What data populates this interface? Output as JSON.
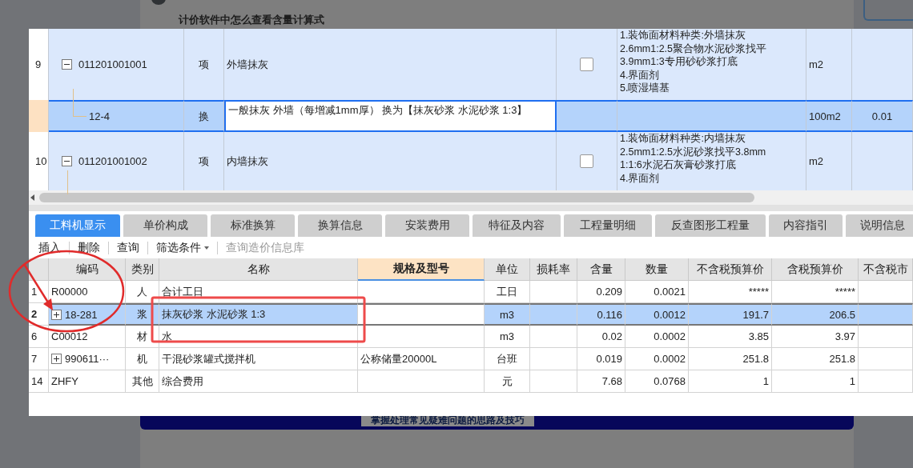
{
  "background_page": {
    "article_title": "计价软件中怎么查看含量计算式",
    "banner_text": "掌握处理常见疑难问题的思路及技巧"
  },
  "top_grid": {
    "rows": [
      {
        "number": "9",
        "code": "011201001001",
        "type": "项",
        "name": "外墙抹灰",
        "checked": false,
        "features": "1.装饰面材料种类:外墙抹灰\n2.6mm1:2.5聚合物水泥砂浆找平\n3.9mm1:3专用砂砂浆打底\n4.界面剂\n5.喷湿墙基",
        "unit": "m2",
        "expanded": true,
        "selected": false,
        "children": [
          {
            "code": "12-4",
            "type": "换",
            "name": "一般抹灰 外墙（每增减1mm厚） 换为【抹灰砂浆 水泥砂浆 1:3】",
            "unit": "100m2",
            "column_8": "0.01",
            "selected": true
          }
        ]
      },
      {
        "number": "10",
        "code": "011201001002",
        "type": "项",
        "name": "内墙抹灰",
        "checked": false,
        "features": "1.装饰面材料种类:内墙抹灰\n2.5mm1:2.5水泥砂浆找平3.8mm\n1:1:6水泥石灰膏砂浆打底\n4.界面剂",
        "unit": "m2",
        "expanded": true,
        "selected": false
      }
    ]
  },
  "tabs": [
    {
      "label": "工料机显示",
      "selected": true
    },
    {
      "label": "单价构成",
      "selected": false
    },
    {
      "label": "标准换算",
      "selected": false
    },
    {
      "label": "换算信息",
      "selected": false
    },
    {
      "label": "安装费用",
      "selected": false
    },
    {
      "label": "特征及内容",
      "selected": false
    },
    {
      "label": "工程量明细",
      "selected": false
    },
    {
      "label": "反查图形工程量",
      "selected": false
    },
    {
      "label": "内容指引",
      "selected": false
    },
    {
      "label": "说明信息",
      "selected": false
    }
  ],
  "toolbar": [
    {
      "label": "插入",
      "kind": "button",
      "disabled": false
    },
    {
      "label": "删除",
      "kind": "button",
      "disabled": false
    },
    {
      "label": "查询",
      "kind": "button",
      "disabled": false
    },
    {
      "label": "筛选条件",
      "kind": "dropdown",
      "disabled": false
    },
    {
      "label": "查询造价信息库",
      "kind": "button",
      "disabled": true
    }
  ],
  "table": {
    "columns": [
      {
        "label": "编码",
        "highlighted": false
      },
      {
        "label": "类别",
        "highlighted": false
      },
      {
        "label": "名称",
        "highlighted": false
      },
      {
        "label": "规格及型号",
        "highlighted": true
      },
      {
        "label": "单位",
        "highlighted": false
      },
      {
        "label": "损耗率",
        "highlighted": false
      },
      {
        "label": "含量",
        "highlighted": false
      },
      {
        "label": "数量",
        "highlighted": false
      },
      {
        "label": "不含税预算价",
        "highlighted": false
      },
      {
        "label": "含税预算价",
        "highlighted": false
      },
      {
        "label": "不含税市",
        "highlighted": false
      }
    ],
    "rows": [
      {
        "number": "1",
        "code": "R00000",
        "type": "人",
        "name": "合计工日",
        "spec": "",
        "unit": "工日",
        "loss_rate": "",
        "content": "0.209",
        "quantity": "0.0021",
        "price_ex_tax": "*****",
        "price_inc_tax": "*****",
        "selected": false
      },
      {
        "number": "2",
        "code": "18-281",
        "expanded": false,
        "type": "浆",
        "name": "抹灰砂浆 水泥砂浆 1:3",
        "spec": "",
        "unit": "m3",
        "loss_rate": "",
        "content": "0.116",
        "quantity": "0.0012",
        "price_ex_tax": "191.7",
        "price_inc_tax": "206.5",
        "selected": true
      },
      {
        "number": "6",
        "code": "C00012",
        "type": "材",
        "name": "水",
        "spec": "",
        "unit": "m3",
        "loss_rate": "",
        "content": "0.02",
        "quantity": "0.0002",
        "price_ex_tax": "3.85",
        "price_inc_tax": "3.97",
        "selected": false
      },
      {
        "number": "7",
        "code": "990611···",
        "expanded": false,
        "type": "机",
        "name": "干混砂浆罐式搅拌机",
        "spec": "公称储量20000L",
        "unit": "台班",
        "loss_rate": "",
        "content": "0.019",
        "quantity": "0.0002",
        "price_ex_tax": "251.8",
        "price_inc_tax": "251.8",
        "selected": false
      },
      {
        "number": "14",
        "code": "ZHFY",
        "type": "其他",
        "name": "综合费用",
        "spec": "",
        "unit": "元",
        "loss_rate": "",
        "content": "7.68",
        "quantity": "0.0768",
        "price_ex_tax": "1",
        "price_inc_tax": "1",
        "selected": false
      }
    ]
  }
}
